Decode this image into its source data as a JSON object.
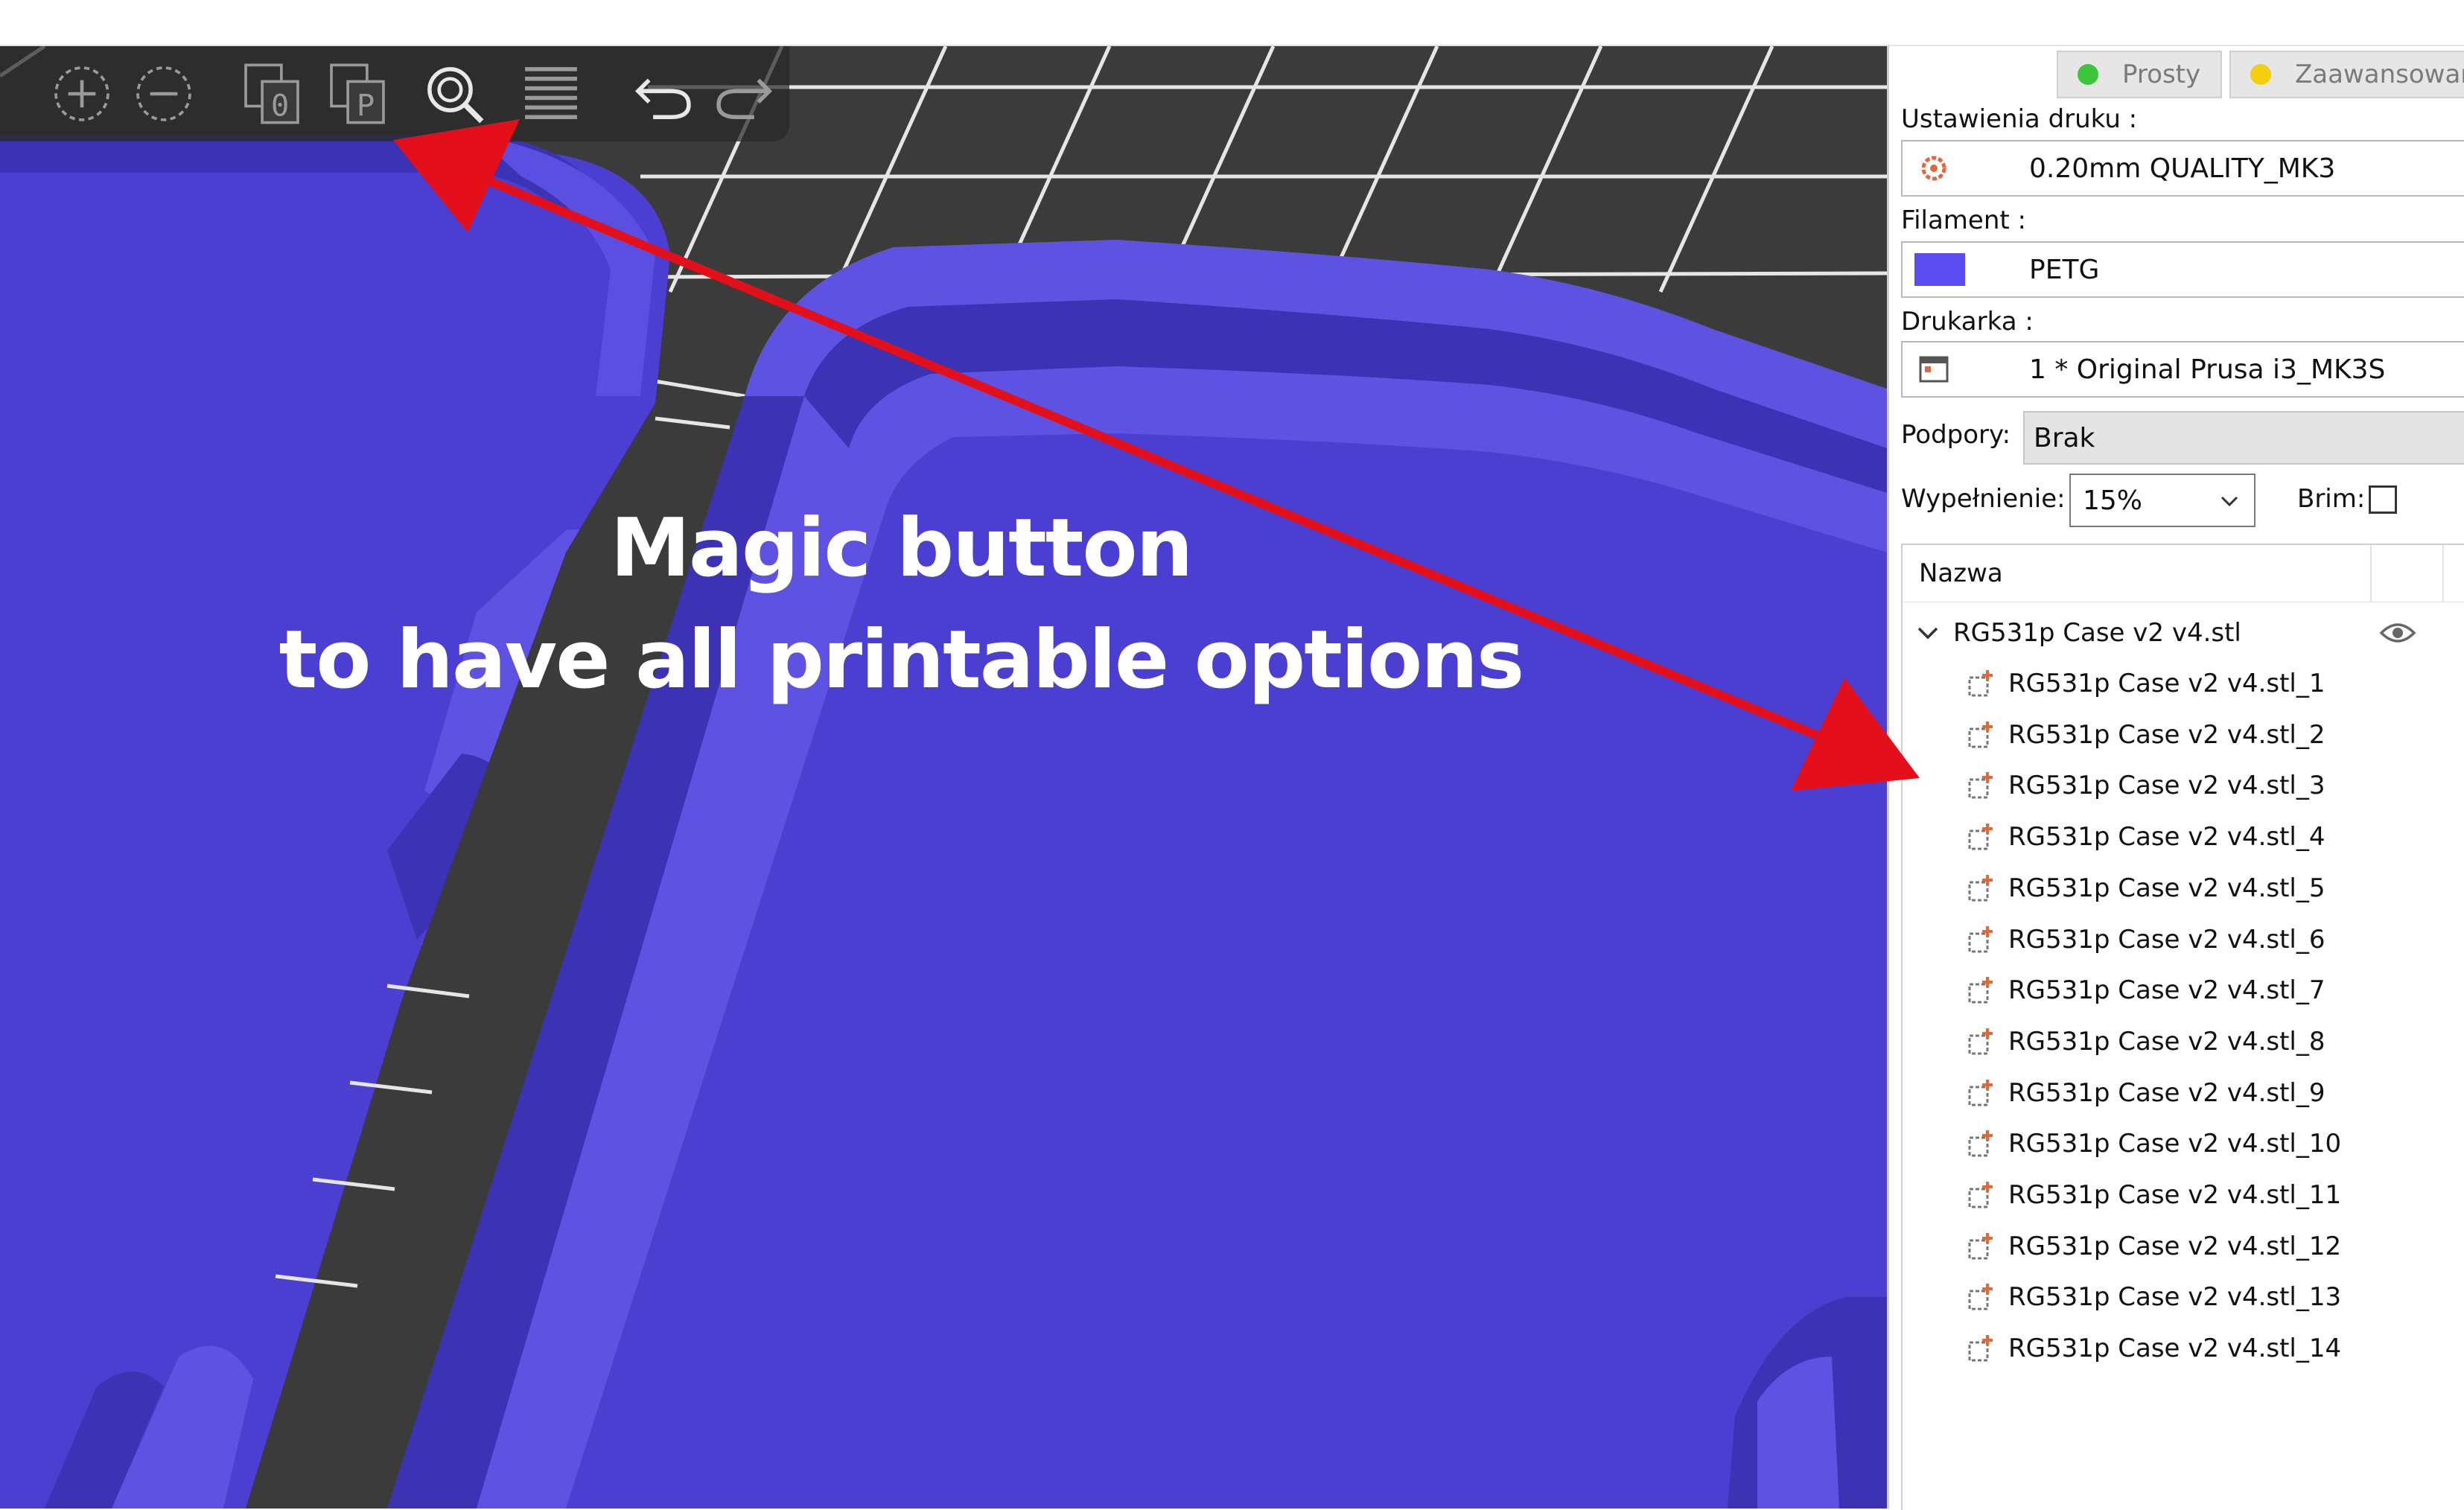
{
  "toolbar": {
    "tools": [
      {
        "name": "add-icon"
      },
      {
        "name": "delete-icon"
      },
      {
        "name": "arrange-icon"
      },
      {
        "name": "place-on-face-icon"
      },
      {
        "name": "search-icon"
      },
      {
        "name": "layers-icon"
      },
      {
        "name": "undo-icon"
      },
      {
        "name": "redo-icon"
      }
    ]
  },
  "annotation": {
    "line1": "Magic button",
    "line2": "to have all printable options",
    "arrow_color": "#e3101c"
  },
  "sidebar": {
    "mode_simple": "Prosty",
    "mode_advanced": "Zaawansowan",
    "mode_simple_color": "#3cc63c",
    "mode_advanced_color": "#f3cf10",
    "print_settings_label": "Ustawienia druku :",
    "print_settings_value": "0.20mm QUALITY_MK3",
    "filament_label": "Filament :",
    "filament_value": "PETG",
    "filament_color": "#5b4df0",
    "printer_label": "Drukarka :",
    "printer_value": "1 * Original Prusa i3_MK3S",
    "supports_label": "Podpory:",
    "supports_value": "Brak",
    "infill_label": "Wypełnienie:",
    "infill_value": "15%",
    "brim_label": "Brim:",
    "brim_checked": false
  },
  "object_list": {
    "column_name": "Nazwa",
    "object": "RG531p Case v2 v4.stl",
    "parts": [
      "RG531p Case v2 v4.stl_1",
      "RG531p Case v2 v4.stl_2",
      "RG531p Case v2 v4.stl_3",
      "RG531p Case v2 v4.stl_4",
      "RG531p Case v2 v4.stl_5",
      "RG531p Case v2 v4.stl_6",
      "RG531p Case v2 v4.stl_7",
      "RG531p Case v2 v4.stl_8",
      "RG531p Case v2 v4.stl_9",
      "RG531p Case v2 v4.stl_10",
      "RG531p Case v2 v4.stl_11",
      "RG531p Case v2 v4.stl_12",
      "RG531p Case v2 v4.stl_13",
      "RG531p Case v2 v4.stl_14"
    ]
  },
  "colors": {
    "model_main": "#4a3fd0",
    "model_light": "#5d52e2",
    "model_dark": "#3b32b4",
    "bed": "#3b3b3b",
    "grid": "#e8e8e8"
  }
}
